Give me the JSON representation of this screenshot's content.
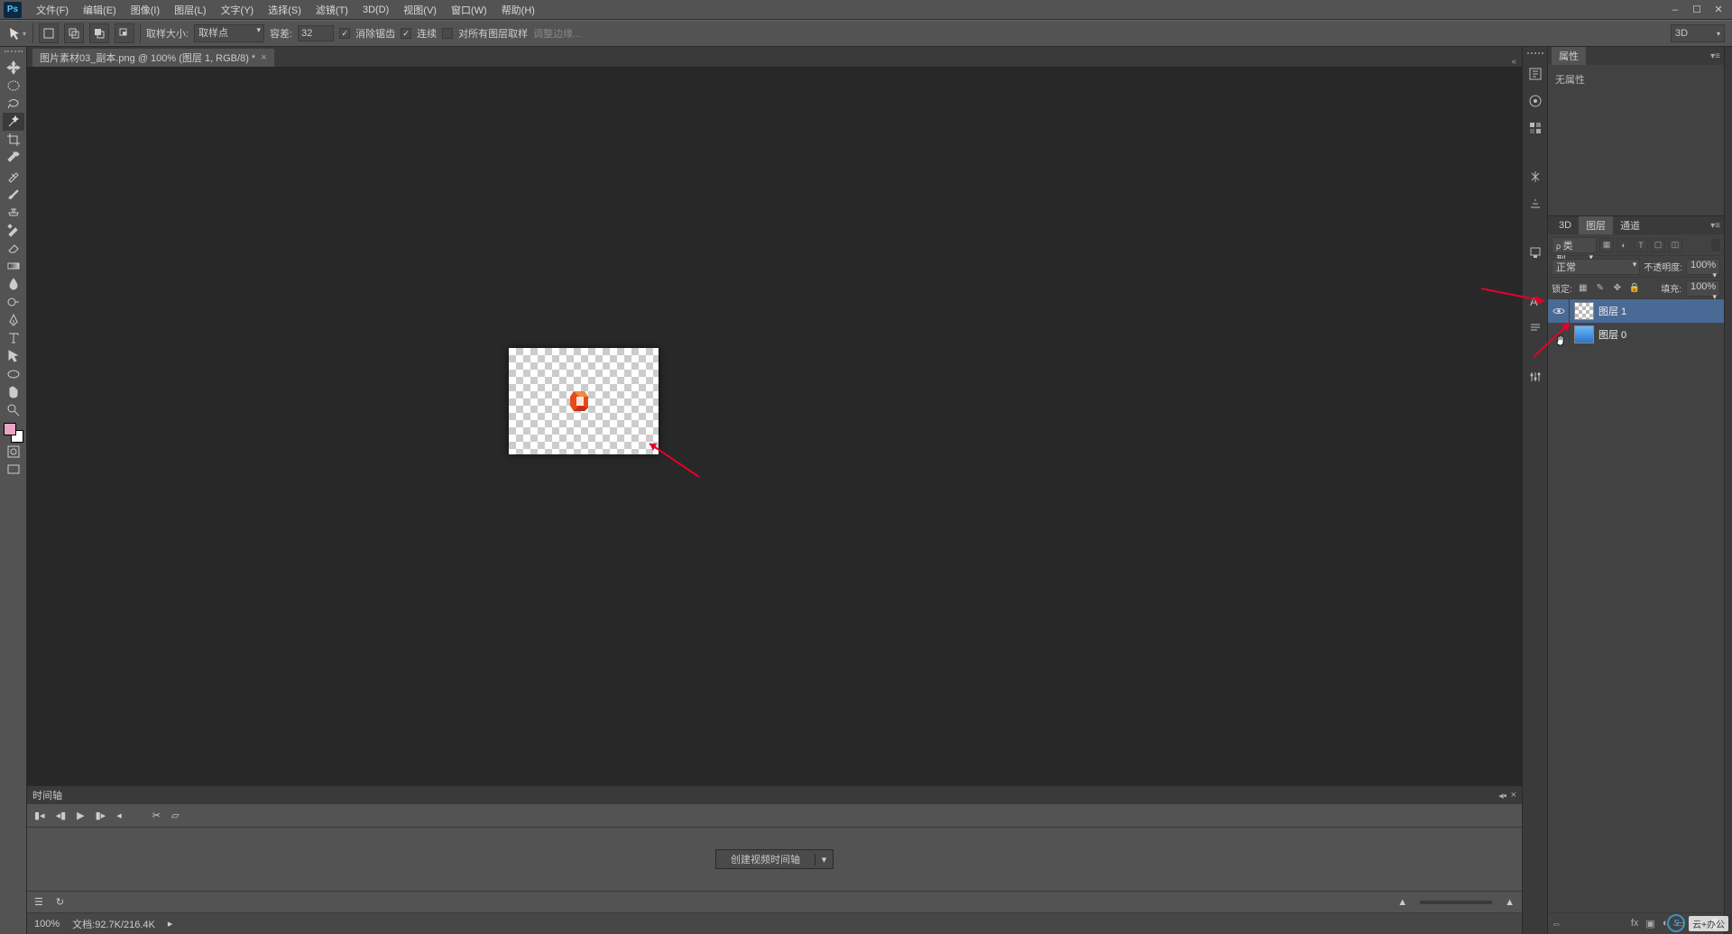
{
  "menubar": {
    "items": [
      "文件(F)",
      "编辑(E)",
      "图像(I)",
      "图层(L)",
      "文字(Y)",
      "选择(S)",
      "滤镜(T)",
      "3D(D)",
      "视图(V)",
      "窗口(W)",
      "帮助(H)"
    ]
  },
  "window_controls": {
    "min": "–",
    "max": "☐",
    "close": "✕"
  },
  "options_bar": {
    "sample_size_label": "取样大小:",
    "sample_size_value": "取样点",
    "tolerance_label": "容差:",
    "tolerance_value": "32",
    "antialias_label": "消除锯齿",
    "contiguous_label": "连续",
    "all_layers_label": "对所有图层取样",
    "refine_label": "调整边缘...",
    "workspace_mode": "3D"
  },
  "document_tab": {
    "title": "图片素材03_副本.png @ 100% (图层 1, RGB/8) *"
  },
  "timeline": {
    "title": "时间轴",
    "create_button": "创建视频时间轴",
    "footer_zoom": "100%",
    "footer_doc": "文档:92.7K/216.4K"
  },
  "properties_panel": {
    "tab": "属性",
    "no_props": "无属性"
  },
  "layers_panel": {
    "tabs": [
      "3D",
      "图层",
      "通道"
    ],
    "filter_kind": "类型",
    "blend_mode": "正常",
    "opacity_label": "不透明度:",
    "opacity_value": "100%",
    "lock_label": "锁定:",
    "fill_label": "填充:",
    "fill_value": "100%",
    "layers": [
      {
        "name": "图层 1",
        "visible": true,
        "selected": true,
        "thumb": "checker"
      },
      {
        "name": "图层 0",
        "visible": false,
        "selected": false,
        "thumb": "blue"
      }
    ]
  },
  "colors": {
    "foreground": "#e8a5c5",
    "background": "#ffffff"
  }
}
